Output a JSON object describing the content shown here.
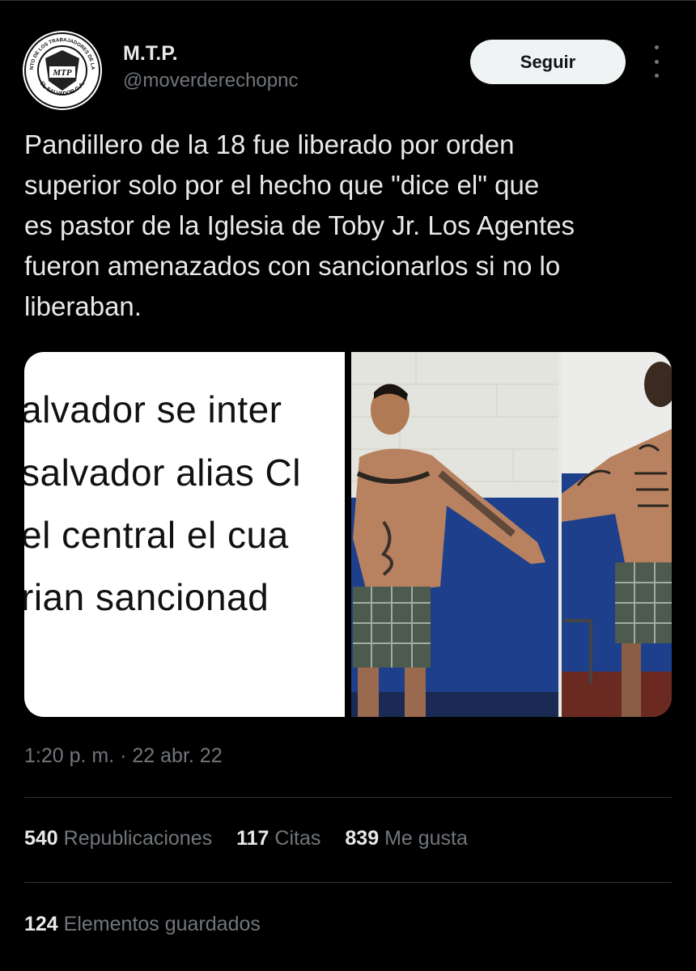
{
  "author": {
    "display_name": "M.T.P.",
    "handle": "@moverderechopnc",
    "avatar_text_top": "MOVIMIENTO DE LOS TRABAJADORES DE LA POLICÍA",
    "avatar_text_bottom": "EL SALVADOR C.A.",
    "avatar_monogram": "MTP"
  },
  "actions": {
    "follow_label": "Seguir",
    "more_icon": "more-vertical-icon"
  },
  "tweet": {
    "lines": [
      "Pandillero de la 18 fue liberado por orden",
      "superior solo por el hecho que \"dice el\" que",
      "es pastor de la Iglesia de Toby Jr. Los Agentes",
      "fueron amenazados con sancionarlos si no lo",
      "liberaban."
    ]
  },
  "media": {
    "document_lines": [
      "alvador se inter",
      "salvador alias Cl",
      "el central el cua",
      "rian sancionad"
    ]
  },
  "meta": {
    "timestamp": "1:20 p. m. · 22 abr. 22"
  },
  "stats": {
    "reposts_count": "540",
    "reposts_label": "Republicaciones",
    "quotes_count": "117",
    "quotes_label": "Citas",
    "likes_count": "839",
    "likes_label": "Me gusta",
    "bookmarks_count": "124",
    "bookmarks_label": "Elementos guardados"
  },
  "colors": {
    "background": "#000000",
    "text_primary": "#e7e9ea",
    "text_secondary": "#71767b",
    "divider": "#2f3336",
    "button_bg": "#eff3f4"
  }
}
